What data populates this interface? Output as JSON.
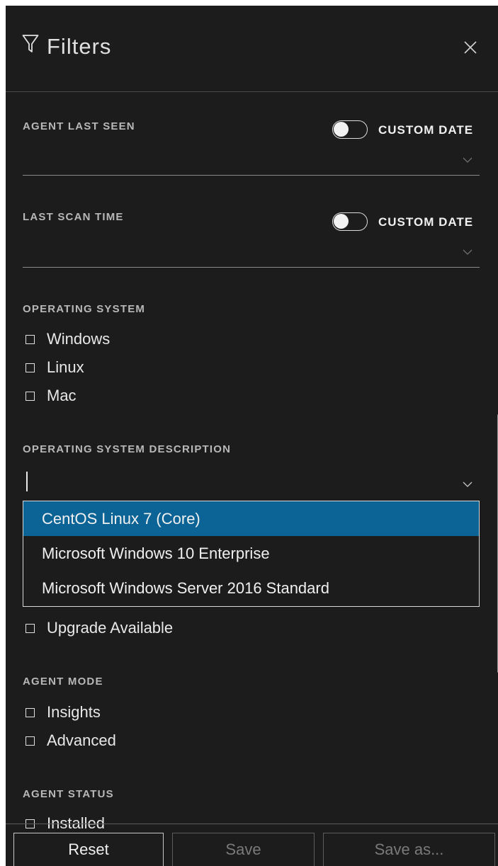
{
  "header": {
    "title": "Filters",
    "filter_icon": "filter-funnel-icon",
    "close_icon": "close-icon"
  },
  "agent_last_seen": {
    "label": "AGENT LAST SEEN",
    "toggle_label": "CUSTOM DATE",
    "toggle_on": false
  },
  "last_scan_time": {
    "label": "LAST SCAN TIME",
    "toggle_label": "CUSTOM DATE",
    "toggle_on": false
  },
  "operating_system": {
    "label": "OPERATING SYSTEM",
    "options": [
      "Windows",
      "Linux",
      "Mac"
    ]
  },
  "os_description": {
    "label": "OPERATING SYSTEM DESCRIPTION",
    "value": "",
    "dropdown_options": [
      "CentOS Linux 7 (Core)",
      "Microsoft Windows 10 Enterprise",
      "Microsoft Windows Server 2016 Standard"
    ],
    "highlighted_option": "CentOS Linux 7 (Core)"
  },
  "upgrade": {
    "option": "Upgrade Available"
  },
  "agent_mode": {
    "label": "AGENT MODE",
    "options": [
      "Insights",
      "Advanced"
    ]
  },
  "agent_status": {
    "label": "AGENT STATUS",
    "options": [
      "Installed"
    ]
  },
  "footer": {
    "reset": "Reset",
    "save": "Save",
    "save_as": "Save as..."
  },
  "colors": {
    "panel_bg": "#1c1c1c",
    "highlight": "#0c6496",
    "text": "#e8e8e8"
  }
}
